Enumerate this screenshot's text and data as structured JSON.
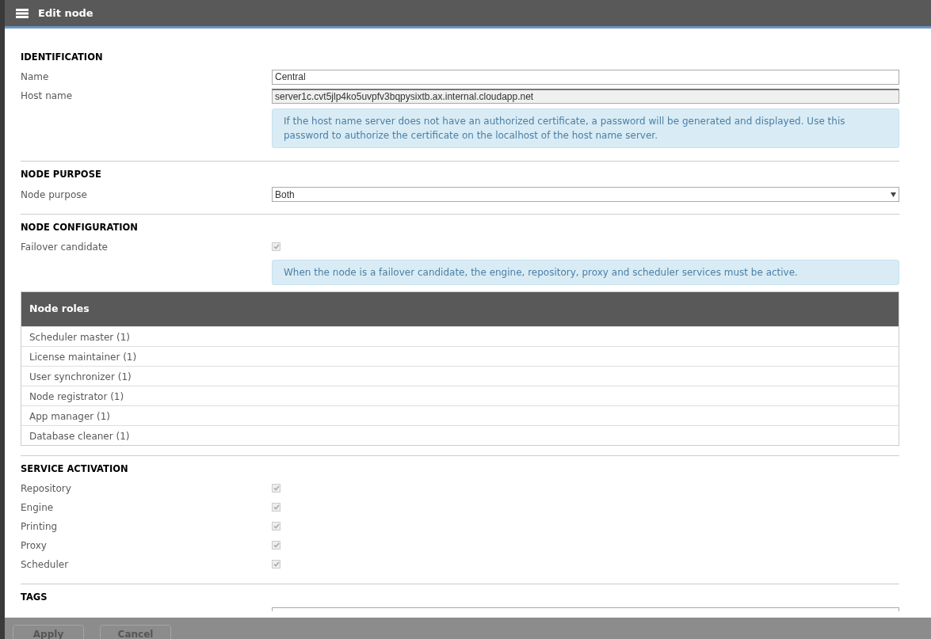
{
  "window": {
    "title": "Edit node"
  },
  "sections": [
    {
      "heading": "IDENTIFICATION",
      "items": [
        {
          "kind": "text",
          "label": "Name",
          "value": "Central",
          "readonly": false
        },
        {
          "kind": "text",
          "label": "Host name",
          "value": "server1c.cvt5jlp4ko5uvpfv3bqpysixtb.ax.internal.cloudapp.net",
          "readonly": true
        },
        {
          "kind": "note",
          "text": "If the host name server does not have an authorized certificate, a password will be generated and displayed. Use this password to authorize the certificate on the localhost of the host name server."
        }
      ]
    },
    {
      "heading": "NODE PURPOSE",
      "items": [
        {
          "kind": "select",
          "label": "Node purpose",
          "value": "Both"
        }
      ]
    },
    {
      "heading": "NODE CONFIGURATION",
      "items": [
        {
          "kind": "checkbox",
          "label": "Failover candidate",
          "checked": true,
          "disabled": true
        },
        {
          "kind": "note",
          "text": "When the node is a failover candidate, the engine, repository, proxy and scheduler services must be active."
        },
        {
          "kind": "table",
          "title": "Node roles",
          "rows": [
            "Scheduler master (1)",
            "License maintainer (1)",
            "User synchronizer (1)",
            "Node registrator (1)",
            "App manager (1)",
            "Database cleaner (1)"
          ]
        }
      ]
    },
    {
      "heading": "SERVICE ACTIVATION",
      "items": [
        {
          "kind": "checkbox",
          "label": "Repository",
          "checked": true,
          "disabled": true
        },
        {
          "kind": "checkbox",
          "label": "Engine",
          "checked": true,
          "disabled": true
        },
        {
          "kind": "checkbox",
          "label": "Printing",
          "checked": true,
          "disabled": true
        },
        {
          "kind": "checkbox",
          "label": "Proxy",
          "checked": true,
          "disabled": true
        },
        {
          "kind": "checkbox",
          "label": "Scheduler",
          "checked": true,
          "disabled": true
        }
      ]
    },
    {
      "heading": "TAGS",
      "items": [
        {
          "kind": "tags"
        }
      ]
    }
  ],
  "buttons": [
    {
      "label": "Apply",
      "disabled": true
    },
    {
      "label": "Cancel",
      "disabled": true
    }
  ]
}
